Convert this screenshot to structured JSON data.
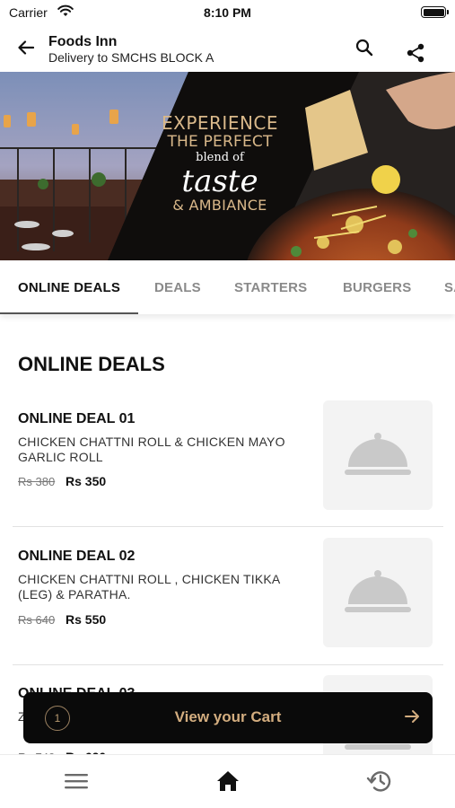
{
  "status_bar": {
    "carrier": "Carrier",
    "time": "8:10 PM"
  },
  "header": {
    "title": "Foods Inn",
    "subtitle": "Delivery to SMCHS BLOCK A"
  },
  "banner": {
    "line1": "EXPERIENCE",
    "line2": "THE PERFECT",
    "line3": "blend of",
    "line4": "taste",
    "line5": "& AMBIANCE"
  },
  "tabs": [
    {
      "label": "ONLINE DEALS",
      "active": true
    },
    {
      "label": "DEALS",
      "active": false
    },
    {
      "label": "STARTERS",
      "active": false
    },
    {
      "label": "BURGERS",
      "active": false
    },
    {
      "label": "SA",
      "active": false
    }
  ],
  "section_title": "ONLINE DEALS",
  "deals": [
    {
      "name": "ONLINE DEAL 01",
      "description": "CHICKEN CHATTNI ROLL & CHICKEN MAYO GARLIC ROLL",
      "old_price": "Rs 380",
      "new_price": "Rs 350"
    },
    {
      "name": "ONLINE DEAL 02",
      "description": "CHICKEN CHATTNI ROLL ,  CHICKEN TIKKA (LEG) & PARATHA.",
      "old_price": "Rs 640",
      "new_price": "Rs 550"
    },
    {
      "name": "ONLINE DEAL 03",
      "description": "Z",
      "old_price": "Rs 740",
      "new_price": "Rs 620"
    }
  ],
  "cart": {
    "count": "1",
    "label": "View your Cart"
  },
  "colors": {
    "accent_gold": "#d3ad7f",
    "cart_bg": "#0a0a0a"
  }
}
